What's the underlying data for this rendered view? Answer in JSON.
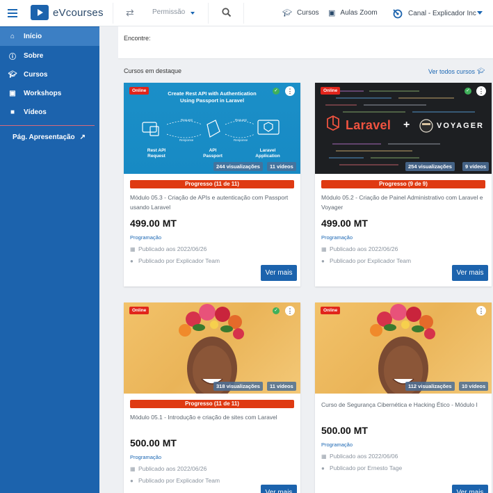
{
  "header": {
    "brand": "eVcourses",
    "permission": "Permissão",
    "links": [
      {
        "label": "Cursos",
        "icon": "graduation-cap-icon"
      },
      {
        "label": "Aulas Zoom",
        "icon": "cubes-icon"
      }
    ],
    "channel": "Canal - Explicador Inc"
  },
  "sidebar": {
    "items": [
      {
        "label": "Início",
        "icon": "home-icon"
      },
      {
        "label": "Sobre",
        "icon": "info-icon"
      },
      {
        "label": "Cursos",
        "icon": "graduation-cap-icon"
      },
      {
        "label": "Workshops",
        "icon": "cubes-icon"
      },
      {
        "label": "Vídeos",
        "icon": "video-camera-icon"
      }
    ],
    "presentation": "Pág. Apresentação"
  },
  "main": {
    "find_label": "Encontre:",
    "section_title": "Cursos em destaque",
    "see_all": "Ver todos cursos",
    "online_label": "Online",
    "more_label": "Ver mais",
    "courses": [
      {
        "thumb": {
          "title": "Create Rest API with Authentication Using Passport in Laravel",
          "request": "Request",
          "response": "Response",
          "nodes": [
            "Rest API Request",
            "API Passport",
            "Laravel Application"
          ]
        },
        "views": "244 visualizações",
        "videos": "11 vídeos",
        "progress": "Progresso (11 de 11)",
        "title": "Módulo 05.3 - Criação de APIs e autenticação com Passport usando Laravel",
        "price": "499.00 MT",
        "category": "Programação",
        "published": "Publicado aos 2022/06/26",
        "author": "Publicado por Explicador Team"
      },
      {
        "thumb": {
          "brand_left": "Laravel",
          "plus": "+",
          "brand_right": "VOYAGER"
        },
        "views": "254 visualizações",
        "videos": "9 vídeos",
        "progress": "Progresso (9 de 9)",
        "title": "Módulo 05.2 - Criação de Painel Administrativo com Laravel e Voyager",
        "price": "499.00 MT",
        "category": "Programação",
        "published": "Publicado aos 2022/06/26",
        "author": "Publicado por Explicador Team"
      },
      {
        "views": "318 visualizações",
        "videos": "11 vídeos",
        "progress": "Progresso (11 de 11)",
        "title": "Módulo 05.1 - Introdução e criação de sites com Laravel",
        "price": "500.00 MT",
        "category": "Programação",
        "published": "Publicado aos 2022/06/26",
        "author": "Publicado por Explicador Team"
      },
      {
        "views": "112 visualizações",
        "videos": "10 vídeos",
        "title": "Curso de Segurança Cibernética e Hacking Ético - Módulo I",
        "price": "500.00 MT",
        "category": "Programação",
        "published": "Publicado aos 2022/06/06",
        "author": "Publicado por Ernesto Tage"
      }
    ]
  },
  "colors": {
    "brand_blue": "#1c63ad",
    "active_item": "#3c7fc4",
    "progress": "#df3a12",
    "online": "#e1251b",
    "check": "#3fb05a"
  }
}
